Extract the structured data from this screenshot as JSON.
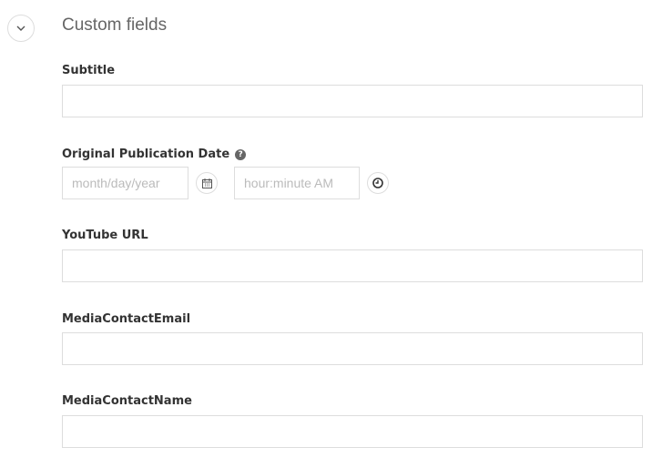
{
  "section": {
    "title": "Custom fields",
    "toggle_icon": "chevron-down-icon"
  },
  "fields": {
    "subtitle": {
      "label": "Subtitle",
      "value": ""
    },
    "pub_date": {
      "label": "Original Publication Date",
      "help_icon": "question-circle-icon",
      "date_placeholder": "month/day/year",
      "time_placeholder": "hour:minute AM",
      "calendar_icon": "calendar-icon",
      "clock_icon": "clock-icon"
    },
    "youtube": {
      "label": "YouTube URL",
      "value": ""
    },
    "media_email": {
      "label": "MediaContactEmail",
      "value": ""
    },
    "media_name": {
      "label": "MediaContactName",
      "value": ""
    }
  }
}
